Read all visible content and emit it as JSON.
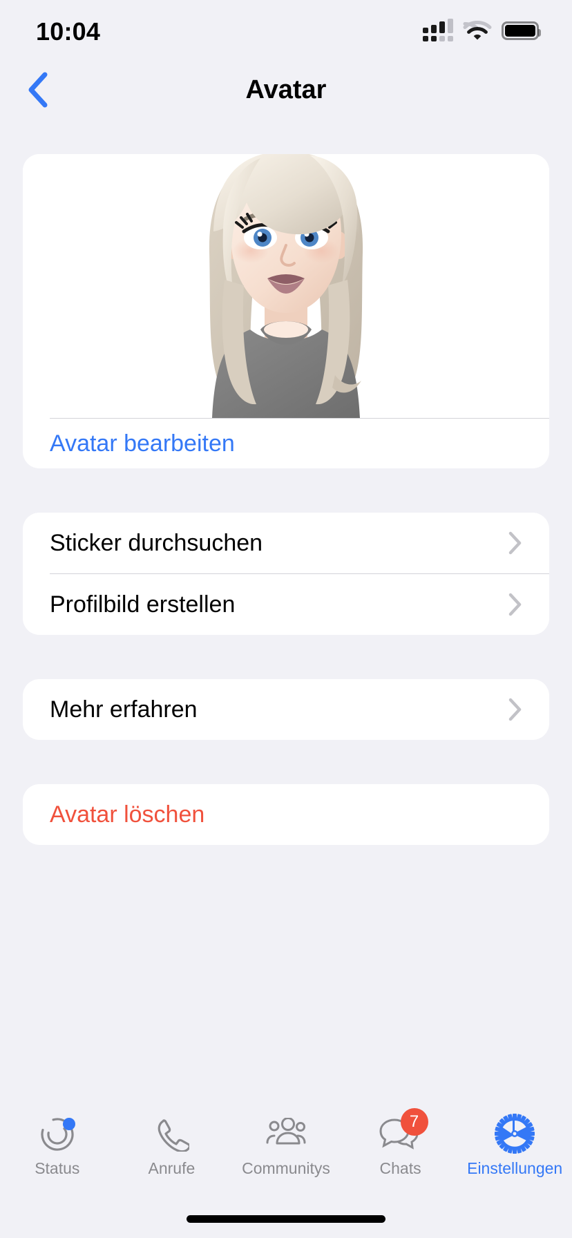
{
  "status_bar": {
    "time": "10:04",
    "cellular_icon": "cellular-signal-icon",
    "cellular_bars_filled": 3,
    "cellular_bars_total": 4,
    "wifi_icon": "wifi-icon",
    "battery_icon": "battery-full-icon",
    "battery_level_percent": 100
  },
  "nav": {
    "back_icon": "chevron-left-icon",
    "title": "Avatar",
    "accent_color": "#3478F6"
  },
  "avatar_card": {
    "avatar_image_alt": "avatar-illustration",
    "avatar": {
      "hair_color": "#E8E1D6",
      "hair_shadow": "#C9C0B2",
      "skin_color": "#F8E3D8",
      "skin_shadow": "#EFCFC0",
      "eye_color": "#4E86C6",
      "lip_color": "#9E6A72",
      "shirt_color": "#7B7B7B",
      "brow_color": "#8C8274"
    },
    "edit_label": "Avatar bearbeiten",
    "edit_color": "#3478F6"
  },
  "sections": [
    {
      "name": "sticker-section",
      "rows": [
        {
          "label": "Sticker durchsuchen",
          "name": "row-sticker-durchsuchen",
          "accessory": "chevron-right-icon",
          "style": "default"
        },
        {
          "label": "Profilbild erstellen",
          "name": "row-profilbild-erstellen",
          "accessory": "chevron-right-icon",
          "style": "default"
        }
      ]
    },
    {
      "name": "info-section",
      "rows": [
        {
          "label": "Mehr erfahren",
          "name": "row-mehr-erfahren",
          "accessory": "chevron-right-icon",
          "style": "default"
        }
      ]
    },
    {
      "name": "destructive-section",
      "rows": [
        {
          "label": "Avatar löschen",
          "name": "row-avatar-loeschen",
          "accessory": "none",
          "style": "danger"
        }
      ]
    }
  ],
  "colors": {
    "background": "#F1F1F6",
    "card": "#FFFFFF",
    "separator": "#D3D3D8",
    "accent_blue": "#3478F6",
    "destructive_red": "#F0513C",
    "inactive_gray": "#8A8A8E"
  },
  "tab_bar": {
    "tabs": [
      {
        "label": "Status",
        "name": "tab-status",
        "icon": "status-rings-icon",
        "active": false,
        "badge": null,
        "badge_type": "dot"
      },
      {
        "label": "Anrufe",
        "name": "tab-anrufe",
        "icon": "phone-icon",
        "active": false,
        "badge": null,
        "badge_type": null
      },
      {
        "label": "Communitys",
        "name": "tab-communitys",
        "icon": "people-group-icon",
        "active": false,
        "badge": null,
        "badge_type": null
      },
      {
        "label": "Chats",
        "name": "tab-chats",
        "icon": "chat-bubbles-icon",
        "active": false,
        "badge": "7",
        "badge_type": "count"
      },
      {
        "label": "Einstellungen",
        "name": "tab-einstellungen",
        "icon": "gear-icon",
        "active": true,
        "badge": null,
        "badge_type": null
      }
    ]
  }
}
